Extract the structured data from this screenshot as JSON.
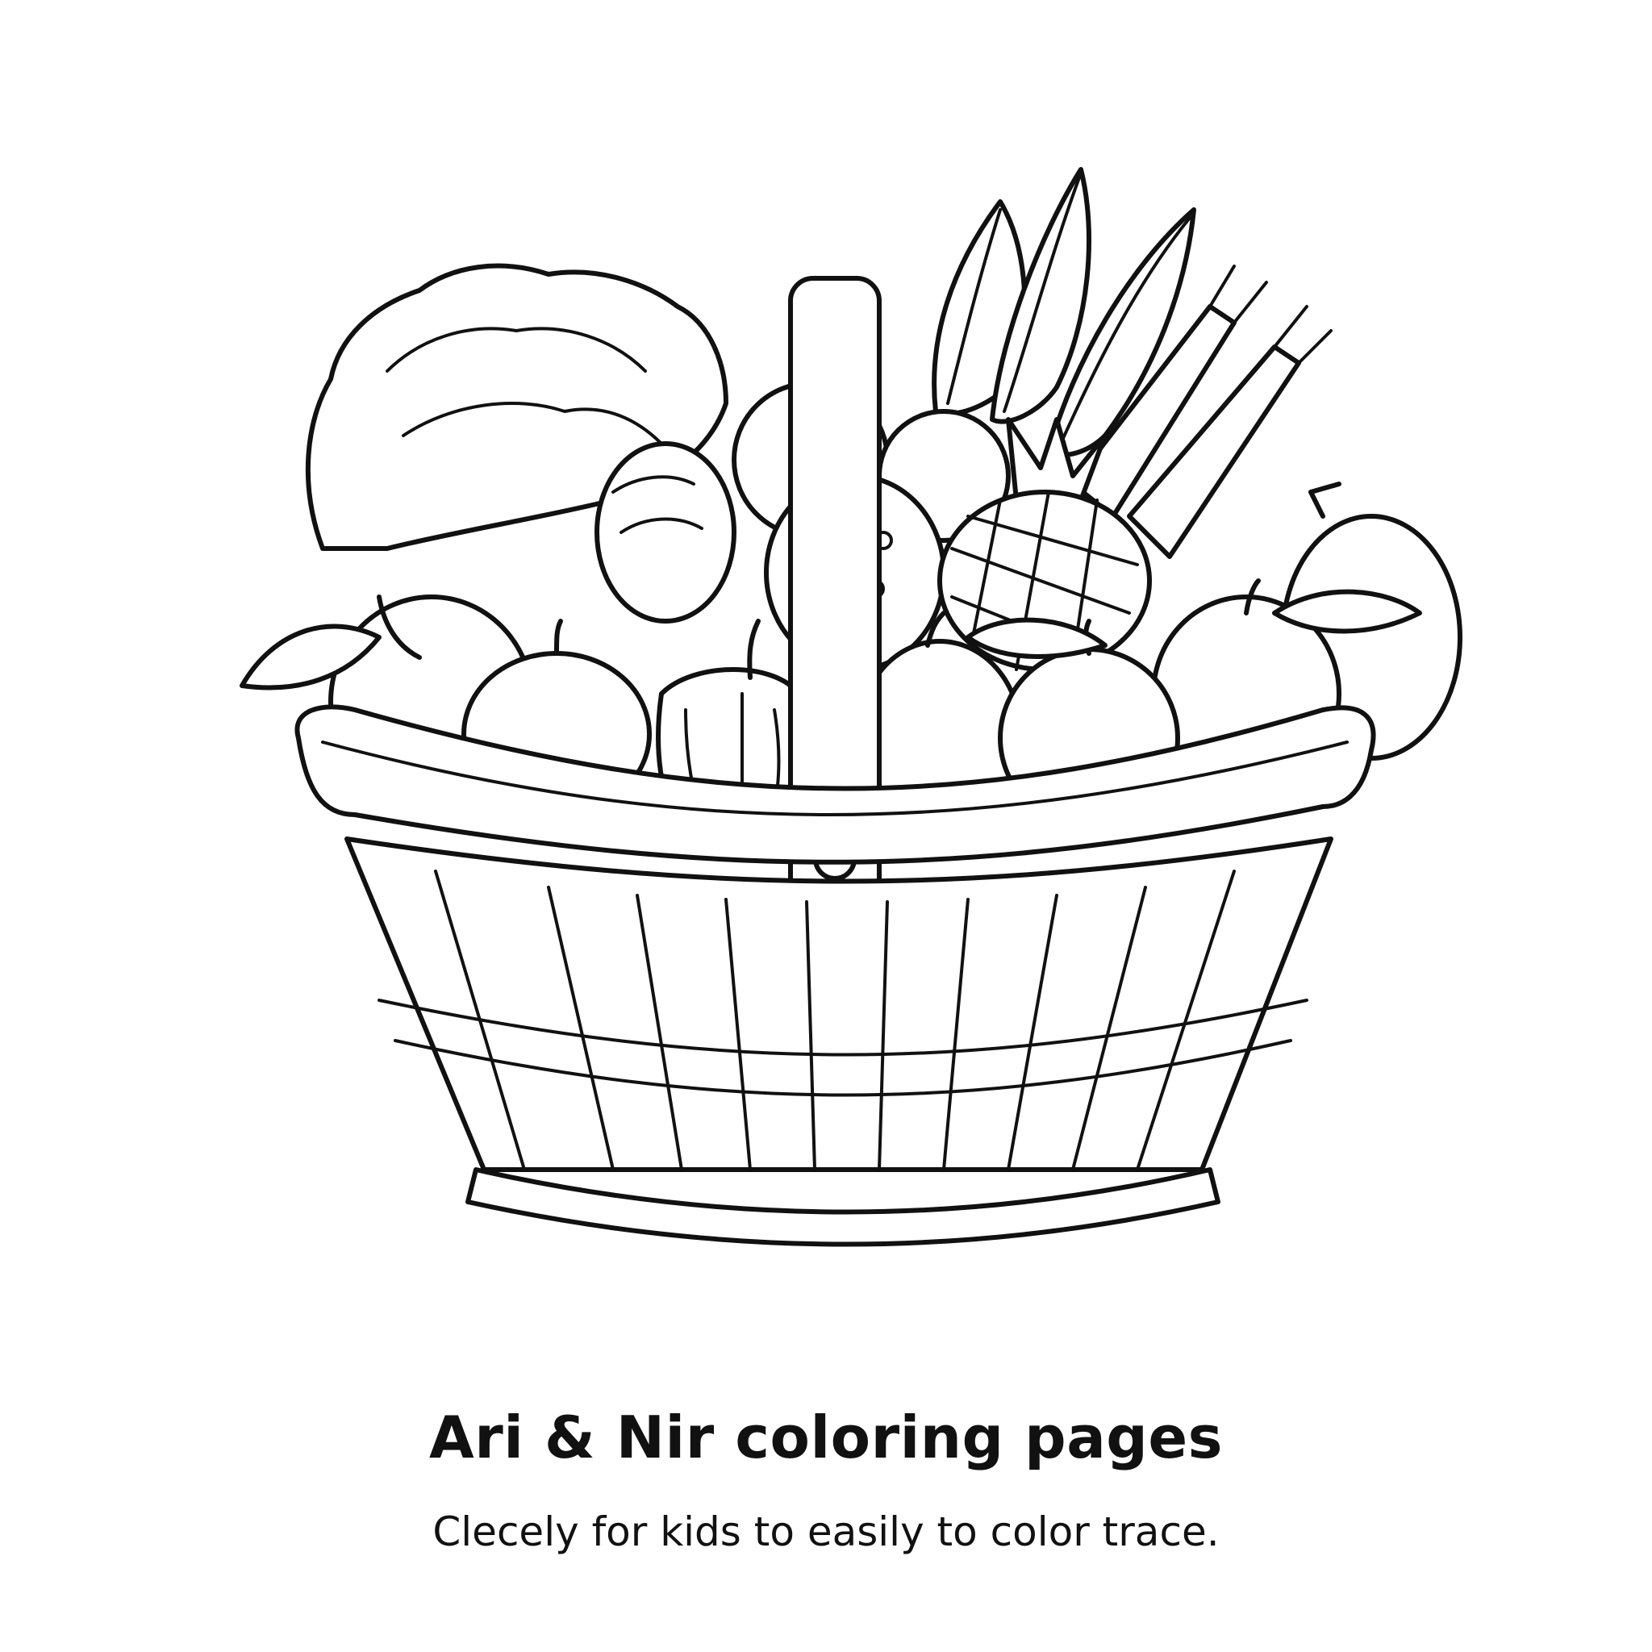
{
  "page": {
    "title": "Ari & Nir coloring pages",
    "subtitle": "Clecely for kids to easily to color trace."
  },
  "illustration": {
    "icon": "fruit-vegetable-basket-icon",
    "line_color": "#111111",
    "background_color": "#ffffff"
  }
}
